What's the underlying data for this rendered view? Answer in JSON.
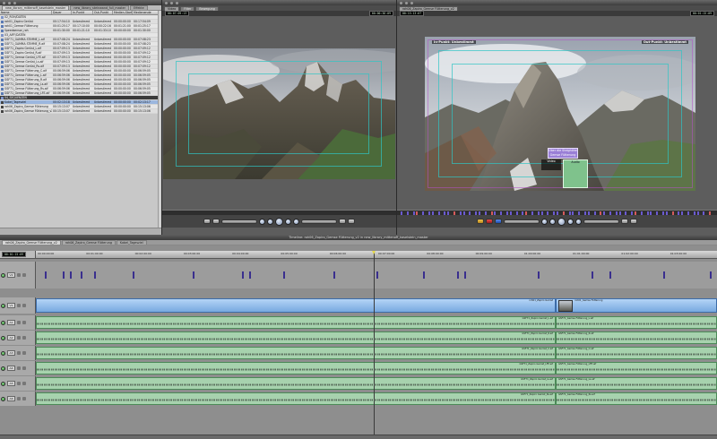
{
  "browser": {
    "title": "",
    "tabs": [
      "new_library_mittenoff_kaselstein_master",
      "new_library_steinwand_full_master",
      "Effekte"
    ],
    "columns": [
      "Name",
      "Dauer",
      "In-Punkt",
      "Out-Punkt",
      "Medien-Start",
      "Medienende"
    ],
    "rows": [
      {
        "name": "02_ROH/DATEN",
        "dur": "",
        "in": "",
        "out": "",
        "ms": "",
        "me": "",
        "type": "folder"
      },
      {
        "name": "roh01_Zapiro Gerüst",
        "dur": "00:17:54:10",
        "in": "Unbestimmt",
        "out": "Unbestimmt",
        "ms": "00:00:00:00",
        "me": "00:17:54:09",
        "type": "clip"
      },
      {
        "name": "roh01_Gemse Fütterung",
        "dur": "00:01:25:17",
        "in": "00:17:10:00",
        "out": "00:00:22:16",
        "ms": "00:01:21:00",
        "me": "00:01:25:17",
        "type": "clip"
      },
      {
        "name": "Speedsensor_roh",
        "dur": "00:01:30:00",
        "in": "00:01:21:10",
        "out": "00:01:33:10",
        "ms": "00:00:00:00",
        "me": "00:01:30:00",
        "type": "clip"
      },
      {
        "name": "03_AIFF/DATEN",
        "dur": "",
        "in": "",
        "out": "",
        "ms": "",
        "me": "",
        "type": "folder"
      },
      {
        "name": "GSF71_GAMMA STIMME_L.aif",
        "dur": "00:07:08:24",
        "in": "Unbestimmt",
        "out": "Unbestimmt",
        "ms": "00:00:00:00",
        "me": "00:07:08:23",
        "type": "clip"
      },
      {
        "name": "GSF71_GAMMA STIMME_R.aif",
        "dur": "00:07:08:24",
        "in": "Unbestimmt",
        "out": "Unbestimmt",
        "ms": "00:00:00:00",
        "me": "00:07:08:23",
        "type": "clip"
      },
      {
        "name": "GSF71_Zapiro Gerüst_L.aif",
        "dur": "00:07:09:13",
        "in": "Unbestimmt",
        "out": "Unbestimmt",
        "ms": "00:00:00:00",
        "me": "00:07:09:12",
        "type": "clip"
      },
      {
        "name": "GSF71_Zapiro Gerüst_R.aif",
        "dur": "00:07:09:13",
        "in": "Unbestimmt",
        "out": "Unbestimmt",
        "ms": "00:00:00:00",
        "me": "00:07:09:12",
        "type": "clip"
      },
      {
        "name": "GSF71_Gemse Gerüst_LFE.aif",
        "dur": "00:07:09:13",
        "in": "Unbestimmt",
        "out": "Unbestimmt",
        "ms": "00:00:00:00",
        "me": "00:07:09:12",
        "type": "clip"
      },
      {
        "name": "GSF71_Gemse Gerüst_Ls.aif",
        "dur": "00:07:09:13",
        "in": "Unbestimmt",
        "out": "Unbestimmt",
        "ms": "00:00:00:00",
        "me": "00:07:09:12",
        "type": "clip"
      },
      {
        "name": "GSF71_Gemse Gerüst_Rs.aif",
        "dur": "00:07:09:13",
        "in": "Unbestimmt",
        "out": "Unbestimmt",
        "ms": "00:00:00:00",
        "me": "00:07:09:12",
        "type": "clip"
      },
      {
        "name": "GSF71_Gemse Fütterung_C.aif",
        "dur": "00:06:59:06",
        "in": "Unbestimmt",
        "out": "Unbestimmt",
        "ms": "00:00:00:00",
        "me": "00:06:59:05",
        "type": "clip"
      },
      {
        "name": "GSF71_Gemse Fütterung_L.aif",
        "dur": "00:06:59:06",
        "in": "Unbestimmt",
        "out": "Unbestimmt",
        "ms": "00:00:00:00",
        "me": "00:06:59:05",
        "type": "clip"
      },
      {
        "name": "GSF71_Gemse Fütterung_R.aif",
        "dur": "00:06:59:06",
        "in": "Unbestimmt",
        "out": "Unbestimmt",
        "ms": "00:00:00:00",
        "me": "00:06:59:05",
        "type": "clip"
      },
      {
        "name": "GSF71_Gemse Fütterung_Ls.aif",
        "dur": "00:06:59:06",
        "in": "Unbestimmt",
        "out": "Unbestimmt",
        "ms": "00:00:00:00",
        "me": "00:06:59:05",
        "type": "clip"
      },
      {
        "name": "GSF71_Gemse Fütterung_Rs.aif",
        "dur": "00:06:59:06",
        "in": "Unbestimmt",
        "out": "Unbestimmt",
        "ms": "00:00:00:00",
        "me": "00:06:59:05",
        "type": "clip"
      },
      {
        "name": "GSF71_Gemse Fütterung_LFE.aif",
        "dur": "00:06:59:06",
        "in": "Unbestimmt",
        "out": "Unbestimmt",
        "ms": "00:00:00:00",
        "me": "00:06:59:05",
        "type": "clip"
      },
      {
        "name": "04_SEQUENZEN",
        "dur": "",
        "in": "",
        "out": "",
        "ms": "",
        "me": "",
        "type": "folder",
        "state": "sel"
      },
      {
        "name": "Kabel_Tagesziel",
        "dur": "00:02:13:18",
        "in": "Unbestimmt",
        "out": "Unbestimmt",
        "ms": "00:00:00:00",
        "me": "00:02:13:17",
        "type": "seq",
        "state": "hl"
      },
      {
        "name": "roh06_Zapiro_Gemse Fütterung",
        "dur": "00:15:13:07",
        "in": "Unbestimmt",
        "out": "Unbestimmt",
        "ms": "00:00:00:00",
        "me": "00:15:13:06",
        "type": "seq"
      },
      {
        "name": "roh06_Zapiro_Gemse Fütterung_v2",
        "dur": "00:15:13:07",
        "in": "Unbestimmt",
        "out": "Unbestimmt",
        "ms": "00:00:00:00",
        "me": "00:15:13:06",
        "type": "seq"
      }
    ]
  },
  "viewer": {
    "tabs": [
      "Video",
      "Filter",
      "Bewegung"
    ],
    "timecode_left": "00:07:09:13",
    "timecode_right": "00:00:38:09"
  },
  "canvas": {
    "tab": "roh06_Zapiro_Gemse Fütterung_v2",
    "timecode_left": "00:15:13:07",
    "timecode_right": "00:01:15:09",
    "in_label": "In-Punkt: Unbestimmt",
    "out_label": "Out-Punkt: Unbestimmt",
    "overlay_title": "Über die Steighöhe",
    "overlay_sub": "Gemse Fütterung",
    "video_label": "Video",
    "audio_label": "Audio"
  },
  "timeline": {
    "title": "Timeline: roh06_Zapiro_Gemse Fütterung_v2 in new_library_mittenoff_kaselstein_master",
    "tabs": [
      "roh06_Zapiro_Gemse Fütterung_v2",
      "roh06_Zapiro_Gemse Fütterung",
      "Kabel_Tagesziel"
    ],
    "current_tc": "00:01:15:09",
    "ruler": [
      "00:00:00:00",
      "00:01:00:00",
      "00:02:00:00",
      "00:03:00:00",
      "00:04:00:00",
      "00:05:00:00",
      "00:06:00:00",
      "00:07:00:00",
      "00:08:00:00",
      "00:09:00:00",
      "01:00:00:00",
      "01:01:00:00",
      "01:02:00:00",
      "01:03:00:00"
    ],
    "tracks": [
      {
        "label": "V2",
        "kind": "marker"
      },
      {
        "label": "V1",
        "kind": "video"
      },
      {
        "label": "A1",
        "kind": "audio"
      },
      {
        "label": "A2",
        "kind": "audio"
      },
      {
        "label": "A3",
        "kind": "audio"
      },
      {
        "label": "A4",
        "kind": "audio"
      },
      {
        "label": "A5",
        "kind": "audio"
      },
      {
        "label": "A6",
        "kind": "audio"
      }
    ],
    "video_clips": [
      "roh01_Zapiro Gerüst",
      "roh01_Gemse Fütterung"
    ],
    "audio_clips": [
      [
        "GSF71_Zapiro Gerüst_L.aif",
        "GSF71_Gemse Fütterung_L.aif"
      ],
      [
        "GSF71_Zapiro Gerüst_R.aif",
        "GSF71_Gemse Fütterung_R.aif"
      ],
      [
        "GSF71_Zapiro Gerüst_C.aif",
        "GSF71_Gemse Fütterung_C.aif"
      ],
      [
        "GSF71_Zapiro Gerüst_LFE.aif",
        "GSF71_Gemse Fütterung_LFE.aif"
      ],
      [
        "GSF71_Zapiro Gerüst_Ls.aif",
        "GSF71_Gemse Fütterung_Ls.aif"
      ],
      [
        "GSF71_Zapiro Gerüst_Rs.aif",
        "GSF71_Gemse Fütterung_Rs.aif"
      ]
    ]
  }
}
